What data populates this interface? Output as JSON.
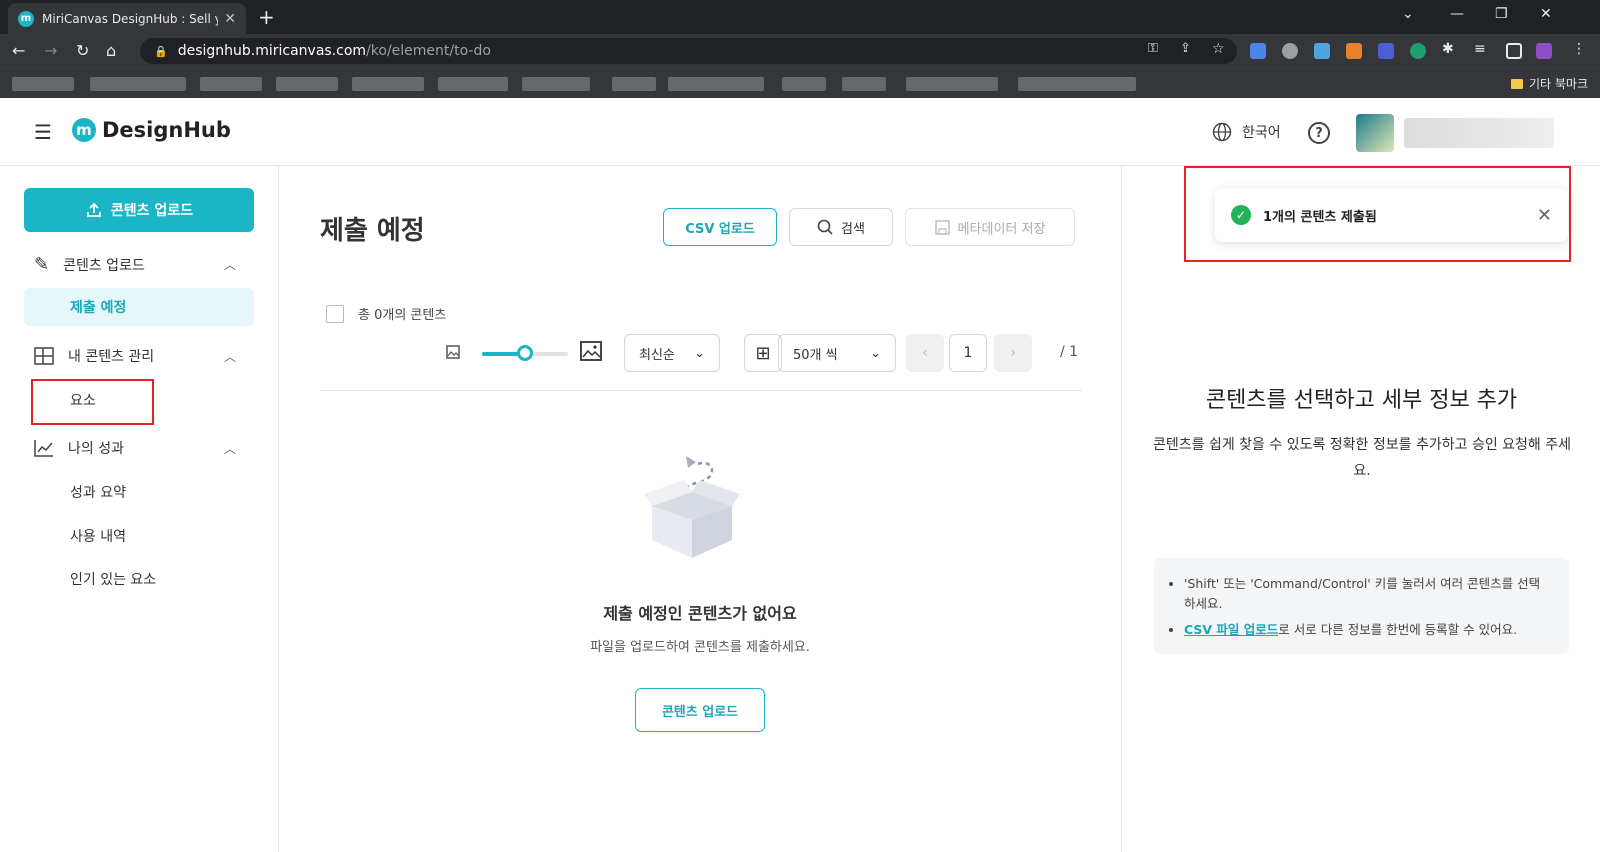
{
  "browser": {
    "tab_title": "MiriCanvas DesignHub : Sell you",
    "tab_favicon": "m",
    "new_tab": "+",
    "url_domain": "designhub.miricanvas.com",
    "url_path": "/ko/element/to-do",
    "bookmarks_other": "기타 북마크"
  },
  "header": {
    "logo_mark": "m",
    "logo_text": "DesignHub",
    "language": "한국어",
    "help": "?"
  },
  "sidebar": {
    "upload_button": "콘텐츠 업로드",
    "sections": [
      {
        "label": "콘텐츠 업로드",
        "items": [
          "제출 예정"
        ]
      },
      {
        "label": "내 콘텐츠 관리",
        "items": [
          "요소"
        ]
      },
      {
        "label": "나의 성과",
        "items": [
          "성과 요약",
          "사용 내역",
          "인기 있는 요소"
        ]
      }
    ]
  },
  "main": {
    "title": "제출 예정",
    "csv_upload": "CSV 업로드",
    "search": "검색",
    "save_metadata": "메타데이터 저장",
    "total_label": "총 0개의 콘텐츠",
    "sort": "최신순",
    "per_page": "50개 씩",
    "page_current": "1",
    "page_total": "/ 1",
    "size_slider": 0.5,
    "empty_title": "제출 예정인 콘텐츠가 없어요",
    "empty_desc": "파일을 업로드하여 콘텐츠를 제출하세요.",
    "empty_button": "콘텐츠 업로드"
  },
  "right_panel": {
    "toast": "1개의 콘텐츠 제출됨",
    "title": "콘텐츠를 선택하고 세부 정보 추가",
    "desc": "콘텐츠를 쉽게 찾을 수 있도록 정확한 정보를 추가하고 승인 요청해 주세요.",
    "tip1": "'Shift' 또는 'Command/Control' 키를 눌러서 여러 콘텐츠를 선택하세요.",
    "tip2_link": "CSV 파일 업로드",
    "tip2_rest": "로 서로 다른 정보를 한번에 등록할 수 있어요."
  },
  "colors": {
    "accent": "#1cb5c6",
    "success": "#22b25a",
    "highlight": "#e52323"
  }
}
